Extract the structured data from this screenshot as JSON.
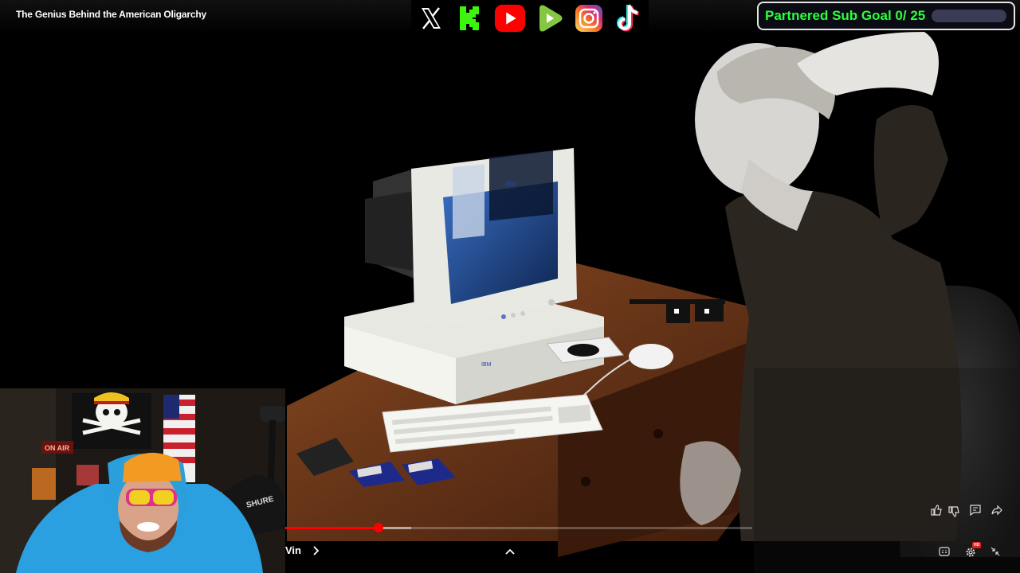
{
  "video": {
    "title": "The Genius Behind the American Oligarchy"
  },
  "social_bar": {
    "icons": [
      "x-icon",
      "kick-icon",
      "youtube-icon",
      "rumble-icon",
      "instagram-icon",
      "tiktok-icon"
    ]
  },
  "sub_goal": {
    "label": "Partnered Sub Goal 0/ 25",
    "progress": 0,
    "label_color": "#2bff3a"
  },
  "scene": {
    "monitor_brand": "IBM",
    "tower_brand": "IBM",
    "mic_brand": "SHURE",
    "sign_text": "ON AIR"
  },
  "player": {
    "played_fraction": 0.2,
    "buffered_fraction": 0.27,
    "chapter_text": "Vin",
    "progress_color": "#ff0000",
    "hd_badge": "HD"
  }
}
